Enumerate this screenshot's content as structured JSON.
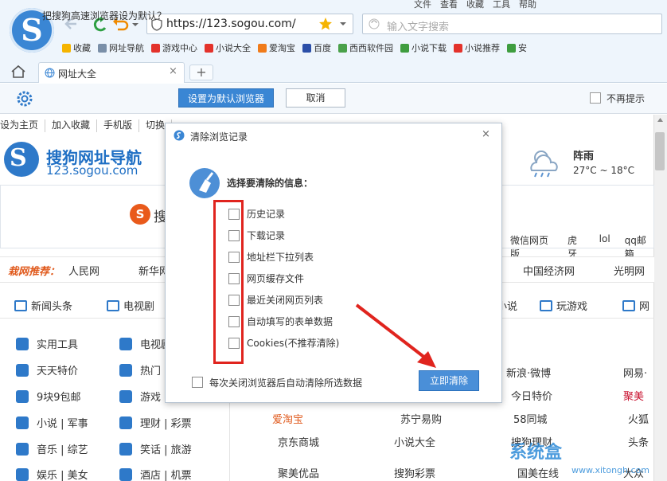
{
  "browser": {
    "menu": [
      "文件",
      "查看",
      "收藏",
      "工具",
      "帮助"
    ],
    "address": "https://123.sogou.com/",
    "search_placeholder": "输入文字搜索",
    "bookmarks": [
      {
        "label": "收藏",
        "color": "#f5b400"
      },
      {
        "label": "网址导航",
        "color": "#7a8fa8"
      },
      {
        "label": "游戏中心",
        "color": "#e3322b"
      },
      {
        "label": "小说大全",
        "color": "#e3322b"
      },
      {
        "label": "爱淘宝",
        "color": "#f07b1a"
      },
      {
        "label": "百度",
        "color": "#2b4fa8"
      },
      {
        "label": "西西软件园",
        "color": "#4aa14a"
      },
      {
        "label": "小说下载",
        "color": "#3f9d3f"
      },
      {
        "label": "小说推荐",
        "color": "#e3322b"
      },
      {
        "label": "安",
        "color": "#3f9d3f"
      }
    ],
    "tab_label": "网址大全",
    "tab_close": "×",
    "tab_add": "+"
  },
  "default_bar": {
    "text": "把搜狗高速浏览器设为默认？",
    "set_button": "设置为默认浏览器",
    "cancel_button": "取消",
    "dont_remind": "不再提示"
  },
  "page_nav": [
    "设为主页",
    "加入收藏",
    "手机版",
    "切换"
  ],
  "site": {
    "title": "搜狗网址导航",
    "url": "123.sogou.com",
    "weather_condition": "阵雨",
    "weather_temp": "27°C ~ 18°C",
    "search_char": "搜",
    "hotwords": [
      "微信网页版",
      "虎牙",
      "lol",
      "qq邮箱"
    ],
    "recommend_label": "栽网推荐：",
    "recommend_links": [
      "人民网",
      "新华网",
      "中国经济网",
      "光明网"
    ],
    "categories": [
      "新闻头条",
      "电视剧",
      "小说",
      "玩游戏",
      "网"
    ],
    "left_list": [
      {
        "a": "实用工具",
        "b": "电视剧"
      },
      {
        "a": "天天特价",
        "b": "热门"
      },
      {
        "a": "9块9包邮",
        "b": "游戏"
      },
      {
        "a": "小说 | 军事",
        "b": "理财 | 彩票"
      },
      {
        "a": "音乐 | 综艺",
        "b": "笑话 | 旅游"
      },
      {
        "a": "娱乐 | 美女",
        "b": "酒店 | 机票"
      }
    ],
    "right_grid": [
      [
        "新浪·微博",
        "网易·"
      ],
      [
        "今日特价",
        "聚美"
      ],
      [
        "爱淘宝",
        "苏宁易购",
        "58同城",
        "火狐"
      ],
      [
        "京东商城",
        "小说大全",
        "搜狗理财",
        "头条"
      ],
      [
        "聚美优品",
        "搜狗彩票",
        "国美在线",
        "大众"
      ]
    ]
  },
  "dialog": {
    "title": "清除浏览记录",
    "close": "×",
    "heading": "选择要清除的信息：",
    "options": [
      "历史记录",
      "下载记录",
      "地址栏下拉列表",
      "网页缓存文件",
      "最近关闭网页列表",
      "自动填写的表单数据",
      "Cookies(不推荐清除)"
    ],
    "auto_clear": "每次关闭浏览器后自动清除所选数据",
    "clear_button": "立即清除"
  },
  "watermark": {
    "main": "系统盒",
    "sub": "www.xitongh.com"
  }
}
